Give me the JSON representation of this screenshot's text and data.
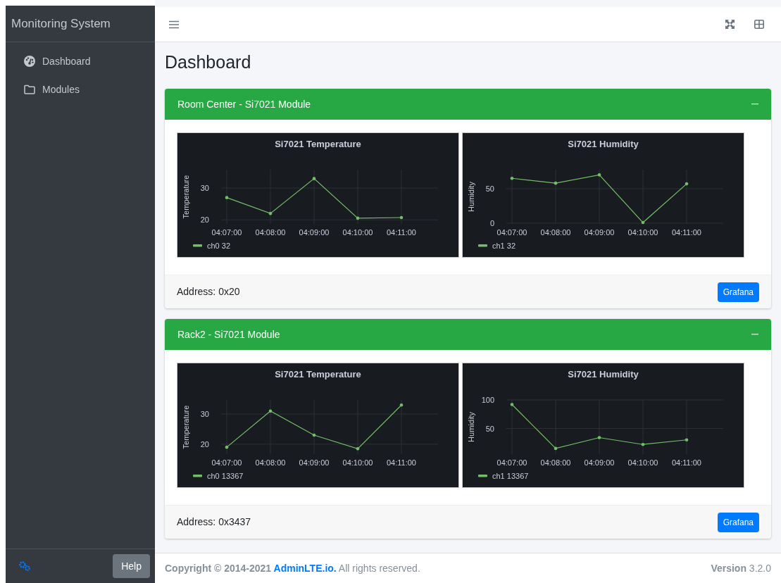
{
  "sidebar": {
    "brand": "Monitoring System",
    "items": [
      {
        "label": "Dashboard",
        "kind": "gauge"
      },
      {
        "label": "Modules",
        "kind": "folder"
      }
    ],
    "help_button": "Help"
  },
  "page_title": "Dashboard",
  "cards": [
    {
      "title": "Room Center - Si7021 Module",
      "address": "Address: 0x20",
      "button": "Grafana",
      "panels": [
        {
          "chart_data": {
            "type": "line",
            "title": "Si7021 Temperature",
            "ylabel": "Temperature",
            "grid": true,
            "categories": [
              "04:07:00",
              "04:08:00",
              "04:09:00",
              "04:10:00",
              "04:11:00"
            ],
            "ylim": [
              18.7,
              35.8
            ],
            "yticks": [
              20,
              30
            ],
            "series": [
              {
                "name": "ch0 32",
                "color": "#73bf69",
                "values": [
                  27,
                  22,
                  33,
                  20.5,
                  20.7
                ]
              }
            ]
          }
        },
        {
          "chart_data": {
            "type": "line",
            "title": "Si7021 Humidity",
            "ylabel": "Humidity",
            "grid": true,
            "categories": [
              "04:07:00",
              "04:08:00",
              "04:09:00",
              "04:10:00",
              "04:11:00"
            ],
            "ylim": [
              -1,
              77.5
            ],
            "yticks": [
              0,
              50
            ],
            "series": [
              {
                "name": "ch1 32",
                "color": "#73bf69",
                "values": [
                  65,
                  58,
                  70,
                  1,
                  57
                ]
              }
            ]
          }
        }
      ]
    },
    {
      "title": "Rack2 - Si7021 Module",
      "address": "Address: 0x3437",
      "button": "Grafana",
      "panels": [
        {
          "chart_data": {
            "type": "line",
            "title": "Si7021 Temperature",
            "ylabel": "Temperature",
            "grid": true,
            "categories": [
              "04:07:00",
              "04:08:00",
              "04:09:00",
              "04:10:00",
              "04:11:00"
            ],
            "ylim": [
              16.7,
              34.7
            ],
            "yticks": [
              20,
              30
            ],
            "series": [
              {
                "name": "ch0 13367",
                "color": "#73bf69",
                "values": [
                  19,
                  31,
                  23,
                  18.5,
                  33
                ]
              }
            ]
          }
        },
        {
          "chart_data": {
            "type": "line",
            "title": "Si7021 Humidity",
            "ylabel": "Humidity",
            "grid": true,
            "categories": [
              "04:07:00",
              "04:08:00",
              "04:09:00",
              "04:10:00",
              "04:11:00"
            ],
            "ylim": [
              5,
              100
            ],
            "yticks": [
              50,
              100
            ],
            "series": [
              {
                "name": "ch1 13367",
                "color": "#73bf69",
                "values": [
                  92,
                  15,
                  34,
                  22,
                  30
                ]
              }
            ]
          }
        }
      ]
    }
  ],
  "footer": {
    "copyright_prefix": "Copyright © 2014-2021",
    "link": "AdminLTE.io.",
    "copyright_suffix": "All rights reserved.",
    "version": "**Version** 3.2.0"
  }
}
